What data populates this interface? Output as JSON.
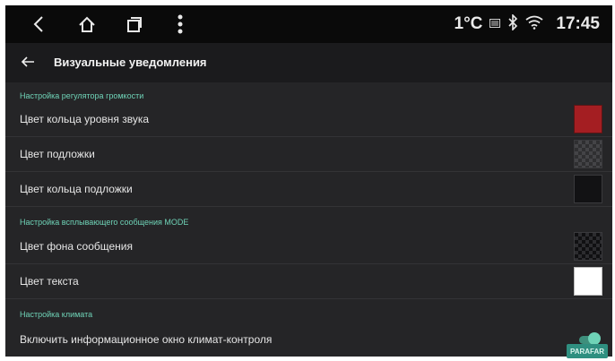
{
  "status": {
    "temperature": "1°C",
    "time": "17:45",
    "nav_icons": [
      "back-icon",
      "home-icon",
      "recents-icon",
      "more-vert-icon"
    ],
    "status_icons": [
      "weather-icon",
      "bluetooth-icon",
      "wifi-icon"
    ]
  },
  "appbar": {
    "title": "Визуальные уведомления"
  },
  "sections": [
    {
      "title": "Настройка регулятора громкости",
      "items": [
        {
          "label": "Цвет кольца уровня звука",
          "swatch_color": "#a41e22"
        },
        {
          "label": "Цвет подложки",
          "swatch": "checker"
        },
        {
          "label": "Цвет кольца подложки",
          "swatch_color": "#121214"
        }
      ]
    },
    {
      "title": "Настройка всплывающего сообщения MODE",
      "items": [
        {
          "label": "Цвет фона сообщения",
          "swatch": "checker-dark"
        },
        {
          "label": "Цвет текста",
          "swatch_color": "#ffffff"
        }
      ]
    },
    {
      "title": "Настройка климата",
      "items": [
        {
          "label": "Включить информационное окно климат-контроля",
          "toggle": true
        }
      ]
    }
  ],
  "accent_color": "#6fd3b7",
  "watermark": "PARAFAR"
}
